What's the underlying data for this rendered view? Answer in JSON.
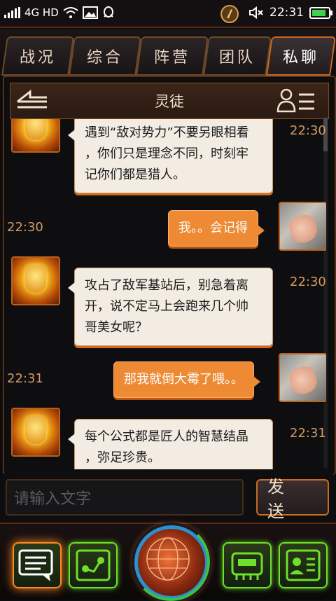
{
  "status": {
    "network": "4G HD",
    "time": "22:31",
    "battery_percent": 85,
    "icons": [
      "signal-icon",
      "wifi-icon",
      "image-icon",
      "qq-icon",
      "app-badge-icon",
      "mute-icon",
      "battery-icon"
    ]
  },
  "tabs": [
    {
      "label": "战况"
    },
    {
      "label": "综合"
    },
    {
      "label": "阵营"
    },
    {
      "label": "团队"
    },
    {
      "label": "私聊"
    }
  ],
  "chat": {
    "title": "灵徒",
    "messages": [
      {
        "from": "contact",
        "text_lines": [
          "遇到“敌对势力”不要另眼相看",
          "，你们只是理念不同，时刻牢",
          "记你们都是猎人。"
        ],
        "time": "22:30"
      },
      {
        "from": "me",
        "text_lines": [
          "我。。会记得"
        ],
        "time": "22:30"
      },
      {
        "from": "contact",
        "text_lines": [
          "攻占了敌军基站后，别急着离",
          "开，说不定马上会跑来几个帅",
          "哥美女呢？"
        ],
        "time": "22:30"
      },
      {
        "from": "me",
        "text_lines": [
          "那我就倒大霉了喂。。"
        ],
        "time": "22:31"
      },
      {
        "from": "contact",
        "text_lines": [
          "每个公式都是匠人的智慧结晶",
          "，弥足珍贵。"
        ],
        "time": "22:31"
      }
    ]
  },
  "input": {
    "placeholder": "请输入文字",
    "send_label": "发 送"
  },
  "dock": {
    "icons": [
      "chat-icon",
      "route-icon",
      "globe-icon",
      "robot-icon",
      "profile-card-icon"
    ]
  },
  "colors": {
    "accent": "#ef8a34",
    "frame": "#c86a20",
    "green": "#6fe02a",
    "bubble_in": "#f2ece2"
  }
}
